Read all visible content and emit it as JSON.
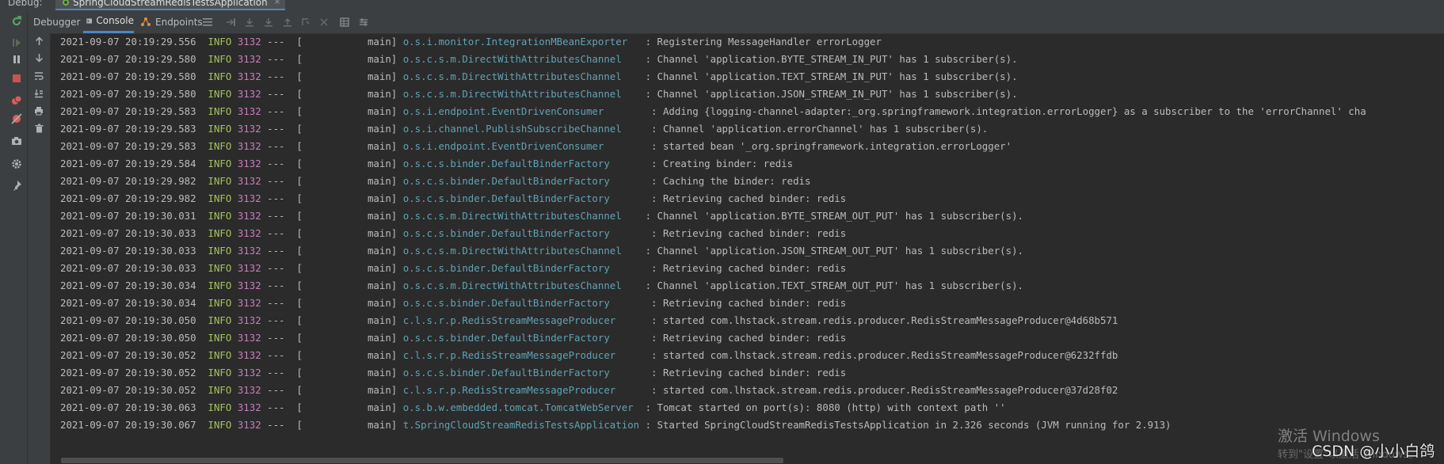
{
  "titlebar": {
    "label": "Debug:",
    "run_tab": "SpringCloudStreamRedisTestsApplication",
    "close": "×"
  },
  "tabs": [
    {
      "label": "Debugger",
      "icon": "none"
    },
    {
      "label": "Console",
      "icon": "console-icon",
      "active": true
    },
    {
      "label": "Endpoints",
      "icon": "endpoints-icon"
    }
  ],
  "colors": {
    "background": "#2b2b2b",
    "toolbar": "#3c3f41",
    "accent": "#4a88c7",
    "info": "#a5c25c",
    "pid": "#c77dbb",
    "logger": "#5fa3b3"
  },
  "log_lines": [
    {
      "ts": "2021-09-07 20:19:29.556",
      "level": "INFO",
      "pid": "3132",
      "thread": "---  [           main]",
      "logger": "o.s.i.monitor.IntegrationMBeanExporter  ",
      "message": " : Registering MessageHandler errorLogger"
    },
    {
      "ts": "2021-09-07 20:19:29.580",
      "level": "INFO",
      "pid": "3132",
      "thread": "---  [           main]",
      "logger": "o.s.c.s.m.DirectWithAttributesChannel   ",
      "message": " : Channel 'application.BYTE_STREAM_IN_PUT' has 1 subscriber(s)."
    },
    {
      "ts": "2021-09-07 20:19:29.580",
      "level": "INFO",
      "pid": "3132",
      "thread": "---  [           main]",
      "logger": "o.s.c.s.m.DirectWithAttributesChannel   ",
      "message": " : Channel 'application.TEXT_STREAM_IN_PUT' has 1 subscriber(s)."
    },
    {
      "ts": "2021-09-07 20:19:29.580",
      "level": "INFO",
      "pid": "3132",
      "thread": "---  [           main]",
      "logger": "o.s.c.s.m.DirectWithAttributesChannel   ",
      "message": " : Channel 'application.JSON_STREAM_IN_PUT' has 1 subscriber(s)."
    },
    {
      "ts": "2021-09-07 20:19:29.583",
      "level": "INFO",
      "pid": "3132",
      "thread": "---  [           main]",
      "logger": "o.s.i.endpoint.EventDrivenConsumer       ",
      "message": " : Adding {logging-channel-adapter:_org.springframework.integration.errorLogger} as a subscriber to the 'errorChannel' cha"
    },
    {
      "ts": "2021-09-07 20:19:29.583",
      "level": "INFO",
      "pid": "3132",
      "thread": "---  [           main]",
      "logger": "o.s.i.channel.PublishSubscribeChannel    ",
      "message": " : Channel 'application.errorChannel' has 1 subscriber(s)."
    },
    {
      "ts": "2021-09-07 20:19:29.583",
      "level": "INFO",
      "pid": "3132",
      "thread": "---  [           main]",
      "logger": "o.s.i.endpoint.EventDrivenConsumer       ",
      "message": " : started bean '_org.springframework.integration.errorLogger'"
    },
    {
      "ts": "2021-09-07 20:19:29.584",
      "level": "INFO",
      "pid": "3132",
      "thread": "---  [           main]",
      "logger": "o.s.c.s.binder.DefaultBinderFactory      ",
      "message": " : Creating binder: redis"
    },
    {
      "ts": "2021-09-07 20:19:29.982",
      "level": "INFO",
      "pid": "3132",
      "thread": "---  [           main]",
      "logger": "o.s.c.s.binder.DefaultBinderFactory      ",
      "message": " : Caching the binder: redis"
    },
    {
      "ts": "2021-09-07 20:19:29.982",
      "level": "INFO",
      "pid": "3132",
      "thread": "---  [           main]",
      "logger": "o.s.c.s.binder.DefaultBinderFactory      ",
      "message": " : Retrieving cached binder: redis"
    },
    {
      "ts": "2021-09-07 20:19:30.031",
      "level": "INFO",
      "pid": "3132",
      "thread": "---  [           main]",
      "logger": "o.s.c.s.m.DirectWithAttributesChannel   ",
      "message": " : Channel 'application.BYTE_STREAM_OUT_PUT' has 1 subscriber(s)."
    },
    {
      "ts": "2021-09-07 20:19:30.033",
      "level": "INFO",
      "pid": "3132",
      "thread": "---  [           main]",
      "logger": "o.s.c.s.binder.DefaultBinderFactory      ",
      "message": " : Retrieving cached binder: redis"
    },
    {
      "ts": "2021-09-07 20:19:30.033",
      "level": "INFO",
      "pid": "3132",
      "thread": "---  [           main]",
      "logger": "o.s.c.s.m.DirectWithAttributesChannel   ",
      "message": " : Channel 'application.JSON_STREAM_OUT_PUT' has 1 subscriber(s)."
    },
    {
      "ts": "2021-09-07 20:19:30.033",
      "level": "INFO",
      "pid": "3132",
      "thread": "---  [           main]",
      "logger": "o.s.c.s.binder.DefaultBinderFactory      ",
      "message": " : Retrieving cached binder: redis"
    },
    {
      "ts": "2021-09-07 20:19:30.034",
      "level": "INFO",
      "pid": "3132",
      "thread": "---  [           main]",
      "logger": "o.s.c.s.m.DirectWithAttributesChannel   ",
      "message": " : Channel 'application.TEXT_STREAM_OUT_PUT' has 1 subscriber(s)."
    },
    {
      "ts": "2021-09-07 20:19:30.034",
      "level": "INFO",
      "pid": "3132",
      "thread": "---  [           main]",
      "logger": "o.s.c.s.binder.DefaultBinderFactory      ",
      "message": " : Retrieving cached binder: redis"
    },
    {
      "ts": "2021-09-07 20:19:30.050",
      "level": "INFO",
      "pid": "3132",
      "thread": "---  [           main]",
      "logger": "c.l.s.r.p.RedisStreamMessageProducer     ",
      "message": " : started com.lhstack.stream.redis.producer.RedisStreamMessageProducer@4d68b571"
    },
    {
      "ts": "2021-09-07 20:19:30.050",
      "level": "INFO",
      "pid": "3132",
      "thread": "---  [           main]",
      "logger": "o.s.c.s.binder.DefaultBinderFactory      ",
      "message": " : Retrieving cached binder: redis"
    },
    {
      "ts": "2021-09-07 20:19:30.052",
      "level": "INFO",
      "pid": "3132",
      "thread": "---  [           main]",
      "logger": "c.l.s.r.p.RedisStreamMessageProducer     ",
      "message": " : started com.lhstack.stream.redis.producer.RedisStreamMessageProducer@6232ffdb"
    },
    {
      "ts": "2021-09-07 20:19:30.052",
      "level": "INFO",
      "pid": "3132",
      "thread": "---  [           main]",
      "logger": "o.s.c.s.binder.DefaultBinderFactory      ",
      "message": " : Retrieving cached binder: redis"
    },
    {
      "ts": "2021-09-07 20:19:30.052",
      "level": "INFO",
      "pid": "3132",
      "thread": "---  [           main]",
      "logger": "c.l.s.r.p.RedisStreamMessageProducer     ",
      "message": " : started com.lhstack.stream.redis.producer.RedisStreamMessageProducer@37d28f02"
    },
    {
      "ts": "2021-09-07 20:19:30.063",
      "level": "INFO",
      "pid": "3132",
      "thread": "---  [           main]",
      "logger": "o.s.b.w.embedded.tomcat.TomcatWebServer ",
      "message": " : Tomcat started on port(s): 8080 (http) with context path ''"
    },
    {
      "ts": "2021-09-07 20:19:30.067",
      "level": "INFO",
      "pid": "3132",
      "thread": "---  [           main]",
      "logger": "t.SpringCloudStreamRedisTestsApplication",
      "message": " : Started SpringCloudStreamRedisTestsApplication in 2.326 seconds (JVM running for 2.913)"
    }
  ],
  "watermark": {
    "activate": "激活 Windows",
    "goto": "转到\"设置\"以激活 Windows。",
    "csdn": "CSDN @小小白鸽"
  }
}
